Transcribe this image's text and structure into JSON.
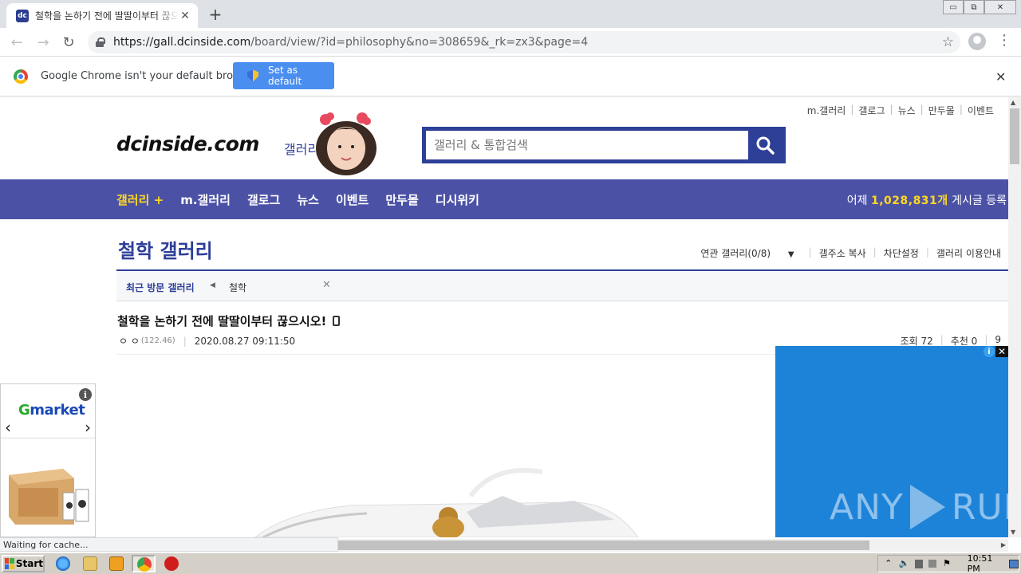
{
  "browser": {
    "tab_title": "철학을 논하기 전에 딸딸이부터 끊으시오! - 철학 갤러리",
    "tab_favicon": "dc",
    "new_tab_symbol": "+",
    "tab_close_symbol": "✕",
    "url_host": "https://gall.dcinside.com",
    "url_path": "/board/view/?id=philosophy&no=308659&_rk=zx3&page=4",
    "star_symbol": "☆",
    "menu_symbol": "⋮",
    "back_symbol": "←",
    "forward_symbol": "→",
    "reload_symbol": "↻",
    "window_controls": [
      "▭",
      "⧉",
      "✕"
    ]
  },
  "infobar": {
    "message": "Google Chrome isn't your default browser",
    "button": "Set as default",
    "close_symbol": "✕"
  },
  "site": {
    "top_links": [
      "m.갤러리",
      "갤로그",
      "뉴스",
      "만두몰",
      "이벤트"
    ],
    "logo": "dcinside.com",
    "logo_sub": "갤러리",
    "search_placeholder": "갤러리 & 통합검색",
    "gnb": {
      "items": [
        "갤러리 +",
        "m.갤러리",
        "갤로그",
        "뉴스",
        "이벤트",
        "만두몰",
        "디시위키"
      ],
      "count_prefix": "어제",
      "count_value": "1,028,831개",
      "count_suffix": "게시글 등록"
    },
    "colors": {
      "brand": "#2e3f98",
      "gnb": "#4b52a6",
      "highlight": "#ffd821"
    }
  },
  "gallery": {
    "title": "철학 갤러리",
    "menu": [
      "연관 갤러리(0/8)",
      "갤주소 복사",
      "차단설정",
      "갤러리 이용안내"
    ],
    "dropdown_symbol": "▼",
    "recent_label": "최근 방문 갤러리",
    "recent_arrow": "◀",
    "recent_item": "철학",
    "recent_close": "✕"
  },
  "post": {
    "title": "철학을 논하기 전에 딸딸이부터 끊으시오!",
    "author": "ㅇ ㅇ",
    "ip": "(122.46)",
    "date": "2020.08.27 09:11:50",
    "views": "조회 72",
    "recommend": "추천 0",
    "extra": "9"
  },
  "ads": {
    "left_brand_g": "G",
    "left_brand_rest": "market",
    "left_info": "i",
    "left_prev": "‹",
    "left_next": "›",
    "right_close": "✕",
    "right_info": "i",
    "watermark_left": "ANY",
    "watermark_right": "RUN"
  },
  "status_bar": "Waiting for cache...",
  "taskbar": {
    "start": "Start",
    "clock": "10:51 PM"
  }
}
